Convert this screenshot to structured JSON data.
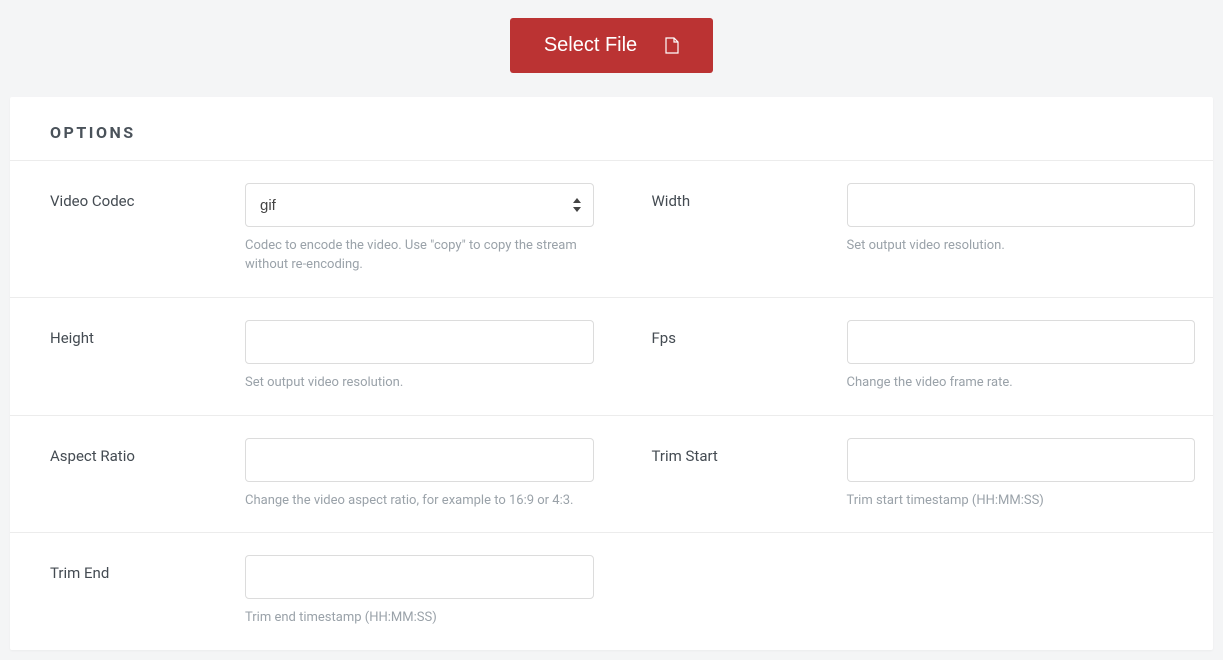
{
  "header": {
    "select_file_label": "Select File"
  },
  "panel": {
    "title": "OPTIONS"
  },
  "fields": {
    "video_codec": {
      "label": "Video Codec",
      "value": "gif",
      "help": "Codec to encode the video. Use \"copy\" to copy the stream without re-encoding."
    },
    "width": {
      "label": "Width",
      "value": "",
      "help": "Set output video resolution."
    },
    "height": {
      "label": "Height",
      "value": "",
      "help": "Set output video resolution."
    },
    "fps": {
      "label": "Fps",
      "value": "",
      "help": "Change the video frame rate."
    },
    "aspect_ratio": {
      "label": "Aspect Ratio",
      "value": "",
      "help": "Change the video aspect ratio, for example to 16:9 or 4:3."
    },
    "trim_start": {
      "label": "Trim Start",
      "value": "",
      "help": "Trim start timestamp (HH:MM:SS)"
    },
    "trim_end": {
      "label": "Trim End",
      "value": "",
      "help": "Trim end timestamp (HH:MM:SS)"
    }
  }
}
